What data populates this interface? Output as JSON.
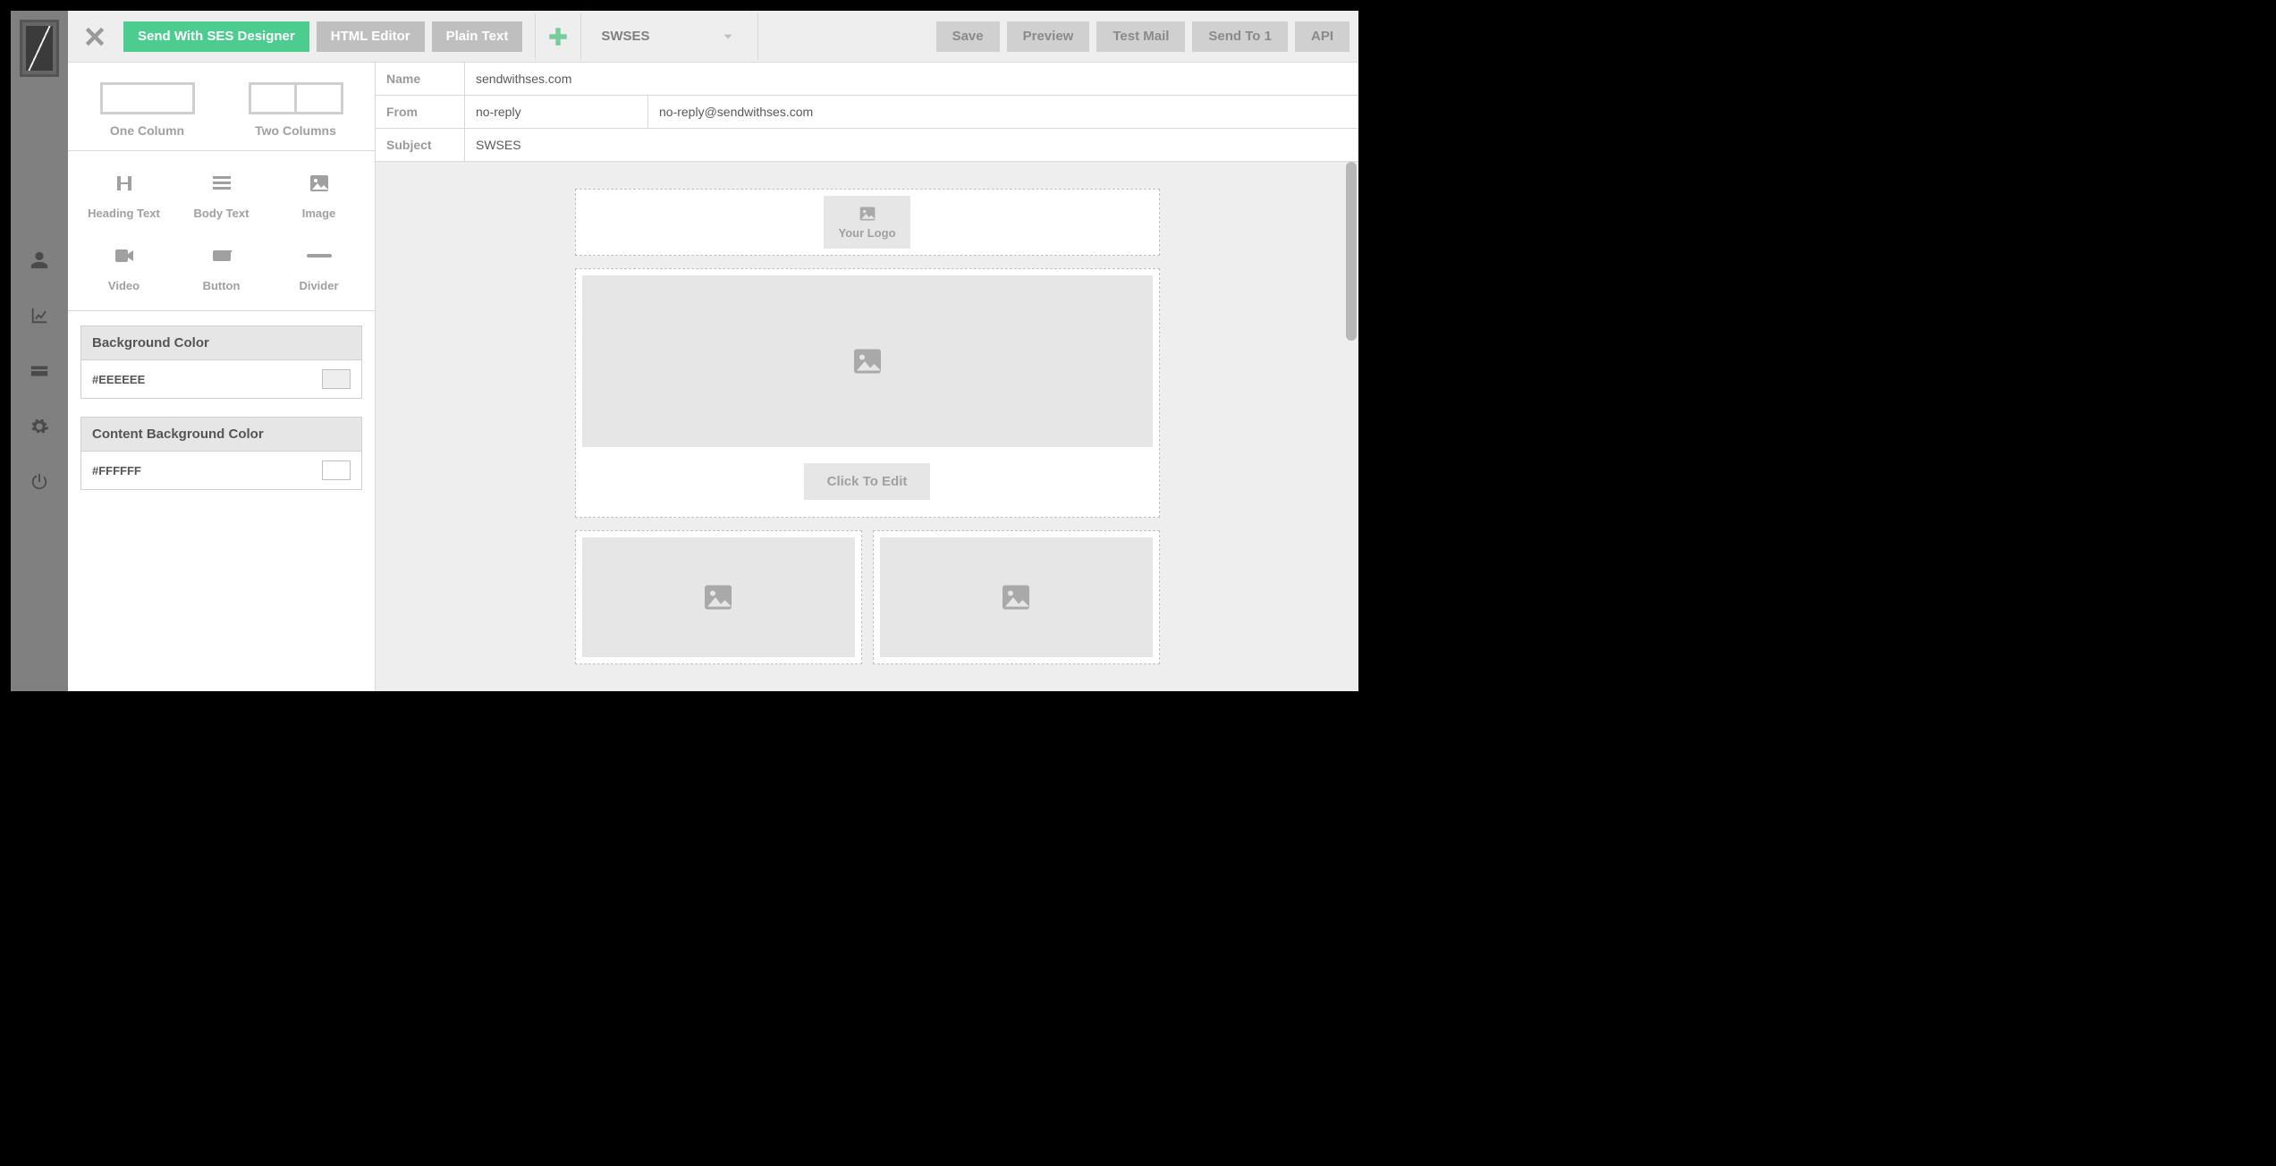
{
  "toolbar": {
    "tabs": {
      "designer": "Send With SES Designer",
      "html": "HTML Editor",
      "plain": "Plain Text"
    },
    "template_name": "SWSES",
    "actions": {
      "save": "Save",
      "preview": "Preview",
      "test": "Test Mail",
      "send": "Send To 1",
      "api": "API"
    }
  },
  "meta": {
    "name_label": "Name",
    "name_value": "sendwithses.com",
    "from_label": "From",
    "from_name": "no-reply",
    "from_email": "no-reply@sendwithses.com",
    "subject_label": "Subject",
    "subject_value": "SWSES"
  },
  "layout": {
    "one_col": "One Column",
    "two_cols": "Two Columns"
  },
  "elements": {
    "heading": "Heading Text",
    "body": "Body Text",
    "image": "Image",
    "video": "Video",
    "button": "Button",
    "divider": "Divider"
  },
  "panels": {
    "bg_label": "Background Color",
    "bg_value": "#EEEEEE",
    "content_bg_label": "Content Background Color",
    "content_bg_value": "#FFFFFF"
  },
  "canvas": {
    "logo_text": "Your Logo",
    "cta_text": "Click To Edit"
  },
  "colors": {
    "accent": "#4dcc8f",
    "bg": "#EEEEEE",
    "content_bg": "#FFFFFF"
  }
}
